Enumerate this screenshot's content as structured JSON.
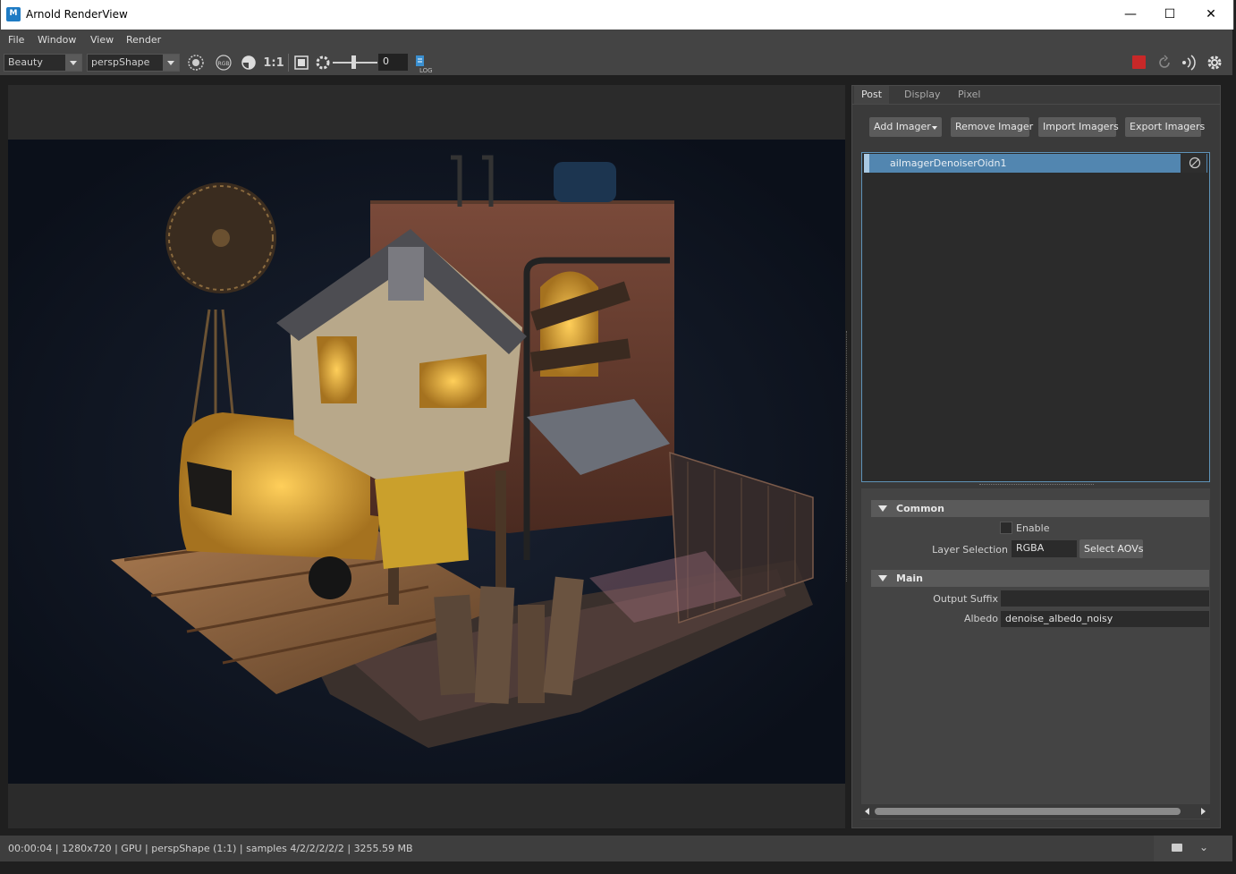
{
  "window": {
    "title": "Arnold RenderView",
    "app_icon_text": "M"
  },
  "menu": [
    "File",
    "Window",
    "View",
    "Render"
  ],
  "toolbar": {
    "aov": "Beauty",
    "camera": "perspShape",
    "ratio": "1:1",
    "exposure_value": "0",
    "log_label": "LOG"
  },
  "panel": {
    "tabs": [
      "Post",
      "Display",
      "Pixel"
    ],
    "active_tab": "Post",
    "buttons": {
      "add": "Add Imager",
      "remove": "Remove Imager",
      "import": "Import Imagers",
      "export": "Export Imagers"
    },
    "imagers": [
      {
        "name": "aiImagerDenoiserOidn1"
      }
    ],
    "sections": {
      "common": {
        "title": "Common",
        "enable_label": "Enable",
        "enable_checked": false,
        "layer_selection_label": "Layer Selection",
        "layer_selection_value": "RGBA",
        "select_aovs": "Select AOVs"
      },
      "main": {
        "title": "Main",
        "output_suffix_label": "Output Suffix",
        "output_suffix_value": "",
        "albedo_label": "Albedo",
        "albedo_value": "denoise_albedo_noisy"
      }
    }
  },
  "status": {
    "text": "00:00:04 | 1280x720 | GPU | perspShape (1:1) | samples 4/2/2/2/2/2 | 3255.59 MB"
  },
  "colors": {
    "accent": "#5286b0",
    "stop_red": "#c82828"
  }
}
